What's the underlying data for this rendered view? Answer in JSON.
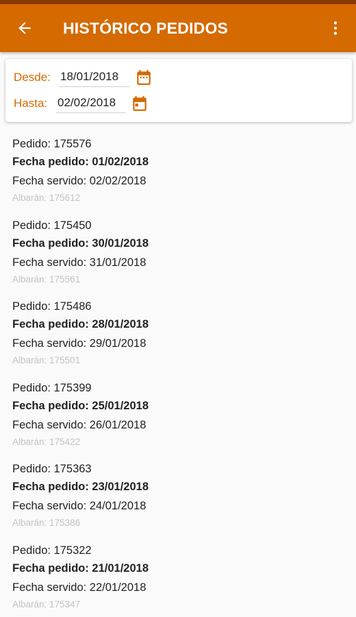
{
  "app": {
    "title": "HISTÓRICO PEDIDOS",
    "accent_color": "#d46a00",
    "status_color": "#8a3a00"
  },
  "icons": {
    "back": "arrow-left-icon",
    "menu": "more-vert-icon",
    "calendar": "calendar-icon"
  },
  "filters": {
    "desde_label": "Desde:",
    "desde_value": "18/01/2018",
    "hasta_label": "Hasta:",
    "hasta_value": "02/02/2018"
  },
  "orders": [
    {
      "pedido": "Pedido: 175576",
      "fecha_pedido": "Fecha pedido: 01/02/2018",
      "fecha_servido": "Fecha servido: 02/02/2018",
      "albaran": "Albarán: 175612"
    },
    {
      "pedido": "Pedido: 175450",
      "fecha_pedido": "Fecha pedido: 30/01/2018",
      "fecha_servido": "Fecha servido: 31/01/2018",
      "albaran": "Albarán: 175561"
    },
    {
      "pedido": "Pedido: 175486",
      "fecha_pedido": "Fecha pedido: 28/01/2018",
      "fecha_servido": "Fecha servido: 29/01/2018",
      "albaran": "Albarán: 175501"
    },
    {
      "pedido": "Pedido: 175399",
      "fecha_pedido": "Fecha pedido: 25/01/2018",
      "fecha_servido": "Fecha servido: 26/01/2018",
      "albaran": "Albarán: 175422"
    },
    {
      "pedido": "Pedido: 175363",
      "fecha_pedido": "Fecha pedido: 23/01/2018",
      "fecha_servido": "Fecha servido: 24/01/2018",
      "albaran": "Albarán: 175386"
    },
    {
      "pedido": "Pedido: 175322",
      "fecha_pedido": "Fecha pedido: 21/01/2018",
      "fecha_servido": "Fecha servido: 22/01/2018",
      "albaran": "Albarán: 175347"
    }
  ]
}
